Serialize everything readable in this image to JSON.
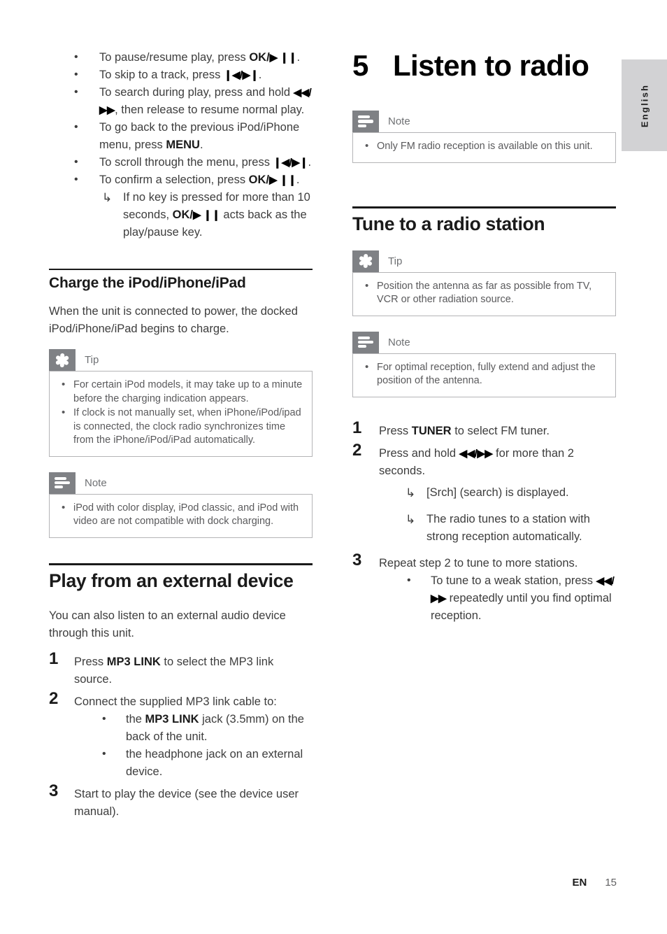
{
  "page": {
    "language_tab": "English",
    "footer_locale": "EN",
    "footer_page_number": "15"
  },
  "left_column": {
    "ipod_control_bullets": [
      {
        "parts": [
          {
            "t": "text",
            "v": "To pause/resume play, press "
          },
          {
            "t": "bold",
            "v": "OK/"
          },
          {
            "t": "glyph",
            "v": "▶ ❙❙"
          },
          {
            "t": "text",
            "v": "."
          }
        ]
      },
      {
        "parts": [
          {
            "t": "text",
            "v": "To skip to a track, press "
          },
          {
            "t": "glyph",
            "v": "❙◀/▶❙"
          },
          {
            "t": "text",
            "v": "."
          }
        ]
      },
      {
        "parts": [
          {
            "t": "text",
            "v": "To search during play, press and hold "
          },
          {
            "t": "glyph",
            "v": "◀◀/▶▶"
          },
          {
            "t": "text",
            "v": ", then release to resume normal play."
          }
        ]
      },
      {
        "parts": [
          {
            "t": "text",
            "v": "To go back to the previous iPod/iPhone menu, press "
          },
          {
            "t": "bold",
            "v": "MENU"
          },
          {
            "t": "text",
            "v": "."
          }
        ]
      },
      {
        "parts": [
          {
            "t": "text",
            "v": "To scroll through the menu, press "
          },
          {
            "t": "glyph",
            "v": "❙◀/▶❙"
          },
          {
            "t": "text",
            "v": "."
          }
        ]
      },
      {
        "parts": [
          {
            "t": "text",
            "v": "To confirm a selection, press "
          },
          {
            "t": "bold",
            "v": "OK/"
          },
          {
            "t": "glyph",
            "v": "▶ ❙❙"
          },
          {
            "t": "text",
            "v": "."
          }
        ]
      }
    ],
    "ipod_control_subitem": {
      "parts": [
        {
          "t": "text",
          "v": "If no key is pressed for more than 10 seconds, "
        },
        {
          "t": "bold",
          "v": "OK/"
        },
        {
          "t": "glyph",
          "v": "▶ ❙❙"
        },
        {
          "t": "text",
          "v": " acts back as the play/pause key."
        }
      ]
    },
    "charge_section": {
      "heading": "Charge the iPod/iPhone/iPad",
      "intro": "When the unit is connected to power, the docked iPod/iPhone/iPad begins to charge.",
      "tip": {
        "label": "Tip",
        "icon": "tip-flower-icon",
        "items": [
          "For certain iPod models, it may take up to a minute before the charging indication appears.",
          "If clock is not manually set, when iPhone/iPod/ipad is connected, the clock radio synchronizes time from the iPhone/iPod/iPad automatically."
        ]
      },
      "note": {
        "label": "Note",
        "icon": "note-bars-icon",
        "items": [
          "iPod with color display, iPod classic, and iPod with video are not compatible with dock charging."
        ]
      }
    },
    "external_device_section": {
      "heading": "Play from an external device",
      "intro": "You can also listen to an external audio device through this unit.",
      "steps": [
        {
          "num": "1",
          "parts": [
            {
              "t": "text",
              "v": "Press "
            },
            {
              "t": "bold",
              "v": "MP3 LINK"
            },
            {
              "t": "text",
              "v": " to select the MP3 link source."
            }
          ]
        },
        {
          "num": "2",
          "parts": [
            {
              "t": "text",
              "v": "Connect the supplied MP3 link cable to:"
            }
          ]
        },
        {
          "num": "3",
          "parts": [
            {
              "t": "text",
              "v": "Start to play the device (see the device user manual)."
            }
          ]
        }
      ],
      "step2_bullets": [
        {
          "parts": [
            {
              "t": "text",
              "v": "the "
            },
            {
              "t": "bold",
              "v": "MP3 LINK"
            },
            {
              "t": "text",
              "v": " jack (3.5mm) on the back of the unit."
            }
          ]
        },
        {
          "parts": [
            {
              "t": "text",
              "v": "the headphone jack on an external device."
            }
          ]
        }
      ]
    }
  },
  "right_column": {
    "chapter": {
      "number": "5",
      "title": "Listen to radio"
    },
    "chapter_note": {
      "label": "Note",
      "icon": "note-bars-icon",
      "items": [
        "Only FM radio reception is available on this unit."
      ]
    },
    "tune_section": {
      "heading": "Tune to a radio station",
      "tip": {
        "label": "Tip",
        "icon": "tip-flower-icon",
        "items": [
          "Position the antenna as far as possible from TV, VCR or other radiation source."
        ]
      },
      "note": {
        "label": "Note",
        "icon": "note-bars-icon",
        "items": [
          "For optimal reception, fully extend and adjust the position of the antenna."
        ]
      },
      "steps": [
        {
          "num": "1",
          "parts": [
            {
              "t": "text",
              "v": "Press "
            },
            {
              "t": "bold",
              "v": "TUNER"
            },
            {
              "t": "text",
              "v": " to select FM tuner."
            }
          ]
        },
        {
          "num": "2",
          "parts": [
            {
              "t": "text",
              "v": "Press and hold "
            },
            {
              "t": "glyph",
              "v": "◀◀/▶▶"
            },
            {
              "t": "text",
              "v": " for more than 2 seconds."
            }
          ]
        },
        {
          "num": "3",
          "parts": [
            {
              "t": "text",
              "v": "Repeat step 2 to tune to more stations."
            }
          ]
        }
      ],
      "step2_results": [
        {
          "parts": [
            {
              "t": "text",
              "v": "[Srch] (search) is displayed."
            }
          ]
        },
        {
          "parts": [
            {
              "t": "text",
              "v": "The radio tunes to a station with strong reception automatically."
            }
          ]
        }
      ],
      "step3_bullets": [
        {
          "parts": [
            {
              "t": "text",
              "v": "To tune to a weak station, press "
            },
            {
              "t": "glyph",
              "v": "◀◀/▶▶"
            },
            {
              "t": "text",
              "v": " repeatedly until you find optimal reception."
            }
          ]
        }
      ]
    }
  }
}
